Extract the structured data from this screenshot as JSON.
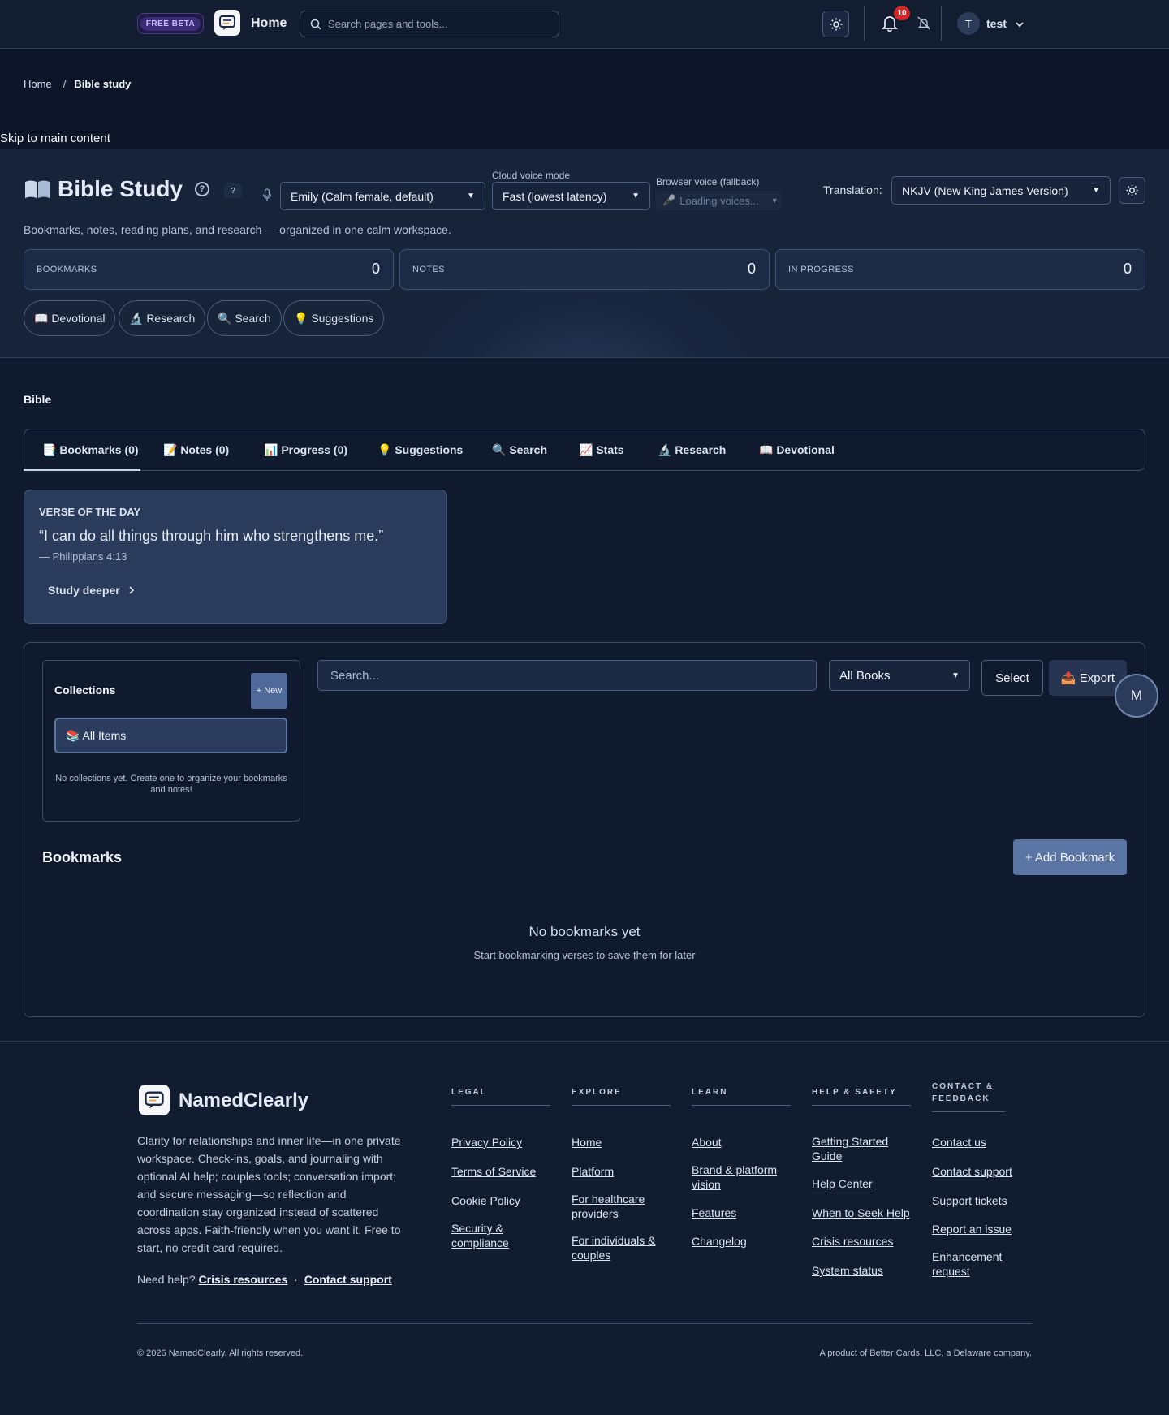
{
  "header": {
    "beta_label": "FREE BETA",
    "home_label": "Home",
    "search_placeholder": "Search pages and tools...",
    "notification_count": "10",
    "avatar_initial": "T",
    "user_name": "test"
  },
  "breadcrumb": {
    "home": "Home",
    "separator": "/",
    "current": "Bible study"
  },
  "skip_link": "Skip to main content",
  "hero": {
    "title": "Bible Study",
    "help_mark": "?",
    "voice_select": "Emily (Calm female, default)",
    "cloud_voice_label": "Cloud voice mode",
    "cloud_voice_select": "Fast (lowest latency)",
    "browser_voice_label": "Browser voice (fallback)",
    "browser_voice_value": "Loading voices...",
    "translation_label": "Translation:",
    "translation_select": "NKJV (New King James Version)",
    "subtitle": "Bookmarks, notes, reading plans, and research — organized in one calm workspace.",
    "stats": [
      {
        "label": "BOOKMARKS",
        "value": "0"
      },
      {
        "label": "NOTES",
        "value": "0"
      },
      {
        "label": "IN PROGRESS",
        "value": "0"
      }
    ],
    "pills": [
      "📖 Devotional",
      "🔬 Research",
      "🔍 Search",
      "💡 Suggestions"
    ]
  },
  "bible": {
    "section_title": "Bible",
    "tabs": [
      "📑 Bookmarks (0)",
      "📝 Notes (0)",
      "📊 Progress (0)",
      "💡 Suggestions",
      "🔍 Search",
      "📈 Stats",
      "🔬 Research",
      "📖 Devotional"
    ],
    "verse_of_day": {
      "heading": "VERSE OF THE DAY",
      "quote": "“I can do all things through him who strengthens me.”",
      "reference": "— Philippians 4:13",
      "button": "Study deeper"
    },
    "collections": {
      "title": "Collections",
      "new_button": "+ New",
      "all_items": "📚 All Items",
      "empty_text": "No collections yet. Create one to organize your bookmarks and notes!"
    },
    "search_placeholder": "Search...",
    "books_select": "All Books",
    "select_button": "Select",
    "export_button": "📤 Export",
    "fab_label": "M",
    "bookmarks_title": "Bookmarks",
    "add_bookmark_button": "+ Add Bookmark",
    "empty_title": "No bookmarks yet",
    "empty_subtitle": "Start bookmarking verses to save them for later"
  },
  "footer": {
    "brand": "NamedClearly",
    "description": "Clarity for relationships and inner life—in one private workspace. Check-ins, goals, and journaling with optional AI help; couples tools; conversation import; and secure messaging—so reflection and coordination stay organized instead of scattered across apps. Faith-friendly when you want it. Free to start, no credit card required.",
    "help_prefix": "Need help?",
    "help_crisis": "Crisis resources",
    "help_dot": "·",
    "help_contact": "Contact support",
    "columns": [
      {
        "heading": "LEGAL",
        "links": [
          "Privacy Policy",
          "Terms of Service",
          "Cookie Policy",
          "Security & compliance"
        ]
      },
      {
        "heading": "EXPLORE",
        "links": [
          "Home",
          "Platform",
          "For healthcare providers",
          "For individuals & couples"
        ]
      },
      {
        "heading": "LEARN",
        "links": [
          "About",
          "Brand & platform vision",
          "Features",
          "Changelog"
        ]
      },
      {
        "heading": "HELP & SAFETY",
        "links": [
          "Getting Started Guide",
          "Help Center",
          "When to Seek Help",
          "Crisis resources",
          "System status"
        ]
      },
      {
        "heading": "CONTACT & FEEDBACK",
        "links": [
          "Contact us",
          "Contact support",
          "Support tickets",
          "Report an issue",
          "Enhancement request"
        ]
      }
    ],
    "copyright": "© 2026 NamedClearly. All rights reserved.",
    "product_of": "A product of Better Cards, LLC, a Delaware company."
  }
}
